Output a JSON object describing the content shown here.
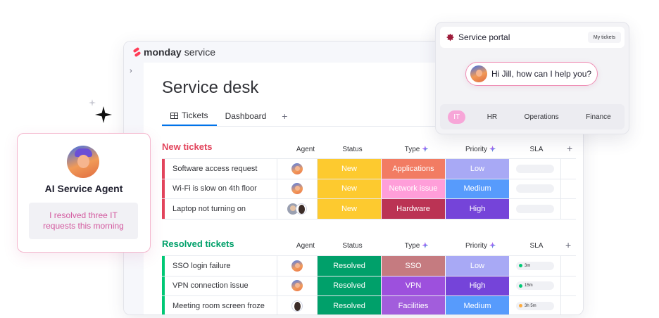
{
  "brand": {
    "name": "monday",
    "product": "service"
  },
  "page": {
    "title": "Service desk"
  },
  "tabs": [
    {
      "label": "Tickets",
      "active": true
    },
    {
      "label": "Dashboard",
      "active": false
    }
  ],
  "columns": {
    "agent": "Agent",
    "status": "Status",
    "type": "Type",
    "priority": "Priority",
    "sla": "SLA"
  },
  "groups": {
    "new": {
      "title": "New tickets",
      "color": "#e2445c",
      "rows": [
        {
          "name": "Software access request",
          "status": "New",
          "type": "Applications",
          "priority": "Low",
          "avatar": "agent"
        },
        {
          "name": "Wi-Fi is slow on 4th floor",
          "status": "New",
          "type": "Network issue",
          "priority": "Medium",
          "avatar": "agent"
        },
        {
          "name": "Laptop not turning on",
          "status": "New",
          "type": "Hardware",
          "priority": "High",
          "avatar": "pair"
        }
      ]
    },
    "resolved": {
      "title": "Resolved tickets",
      "color": "#00c875",
      "rows": [
        {
          "name": "SSO login failure",
          "status": "Resolved",
          "type": "SSO",
          "priority": "Low",
          "sla": "3m",
          "sla_color": "#00c875",
          "avatar": "agent"
        },
        {
          "name": "VPN connection issue",
          "status": "Resolved",
          "type": "VPN",
          "priority": "High",
          "sla": "15m",
          "sla_color": "#00c875",
          "avatar": "agent"
        },
        {
          "name": "Meeting room screen froze",
          "status": "Resolved",
          "type": "Facilities",
          "priority": "Medium",
          "sla": "3h 5m",
          "sla_color": "#fdab3d",
          "avatar": "person"
        }
      ]
    }
  },
  "colors": {
    "status_new": "#fdca2f",
    "status_resolved": "#00a06a",
    "type_applications": "#f27c63",
    "type_network": "#ff9ed9",
    "type_hardware": "#bb3354",
    "type_sso": "#c57b80",
    "type_vpn": "#9d50dd",
    "type_facilities": "#a25ddc",
    "priority_low": "#a8a9f5",
    "priority_medium": "#579bfc",
    "priority_high": "#7544d9"
  },
  "agent_card": {
    "name": "AI Service Agent",
    "message": "I resolved three IT requests this morning"
  },
  "portal": {
    "title": "Service portal",
    "my_tickets": "My tickets",
    "greeting": "Hi Jill, how can I help you?",
    "categories": [
      "IT",
      "HR",
      "Operations",
      "Finance"
    ],
    "active_category": "IT"
  },
  "icons": {
    "sidebar_toggle": "chevron-right-icon",
    "tickets_tab": "table-icon",
    "add": "plus-icon",
    "ai": "sparkle-icon"
  }
}
